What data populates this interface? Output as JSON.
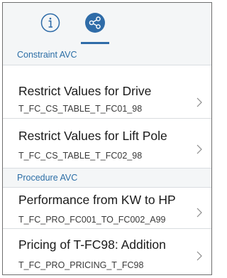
{
  "tabs": [
    {
      "icon": "info-icon",
      "active": false
    },
    {
      "icon": "share-icon",
      "active": true
    }
  ],
  "colors": {
    "accent": "#2f6ca8",
    "section_text": "#2b6ea6",
    "header_bg": "#f4f6f7"
  },
  "sections": [
    {
      "label": "Constraint AVC",
      "items": [
        {
          "title": "Restrict Values for Drive",
          "subtitle": "T_FC_CS_TABLE_T_FC01_98"
        },
        {
          "title": "Restrict Values for Lift Pole",
          "subtitle": "T_FC_CS_TABLE_T_FC02_98"
        }
      ]
    },
    {
      "label": "Procedure AVC",
      "items": [
        {
          "title": "Performance from KW to HP",
          "subtitle": "T_FC_PRO_FC001_TO_FC002_A99"
        },
        {
          "title": "Pricing of T-FC98: Addition",
          "subtitle": "T_FC_PRO_PRICING_T_FC98"
        }
      ]
    }
  ]
}
